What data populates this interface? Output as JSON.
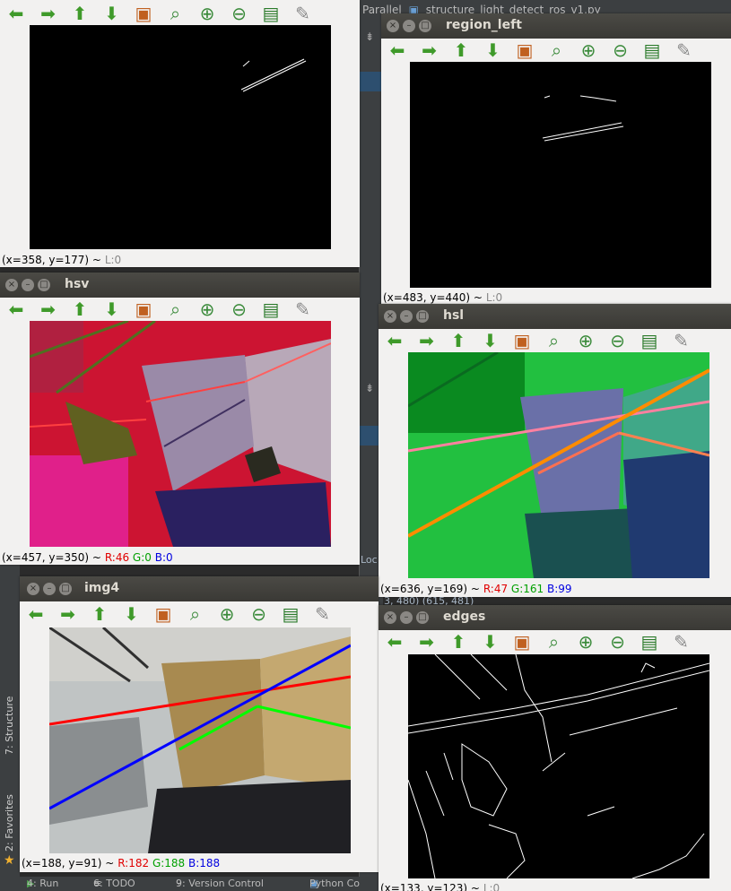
{
  "ide": {
    "tab_label_1": "Parallel",
    "tab_label_2": "structure_light_detect_ros_v1.py",
    "side_tab_structure": "7: Structure",
    "side_tab_favorites": "2: Favorites",
    "bottom_run": "4: Run",
    "bottom_todo": "6: TODO",
    "bottom_vcs": "9: Version Control",
    "bottom_python": "Python Co",
    "misc_loc": "Loc",
    "misc_coords": "3, 480)  (615, 481)"
  },
  "toolbar_icons": [
    "arrow-left-icon",
    "arrow-right-icon",
    "arrow-up-icon",
    "arrow-down-icon",
    "save-image-icon",
    "zoom-area-icon",
    "zoom-in-icon",
    "zoom-out-icon",
    "save-icon",
    "edit-brush-icon"
  ],
  "windows": {
    "mask_top": {
      "status": "(x=358, y=177) ~",
      "channel_label": "L:0"
    },
    "region_left": {
      "title": "region_left",
      "status": "(x=483, y=440) ~",
      "channel_label": "L:0"
    },
    "hsv": {
      "title": "hsv",
      "status": "(x=457, y=350) ~",
      "r": "R:46",
      "g": "G:0",
      "b": "B:0"
    },
    "hsl": {
      "title": "hsl",
      "status": "(x=636, y=169) ~",
      "r": "R:47",
      "g": "G:161",
      "b": "B:99"
    },
    "img4": {
      "title": "img4",
      "status": "(x=188, y=91) ~",
      "r": "R:182",
      "g": "G:188",
      "b": "B:188"
    },
    "edges": {
      "title": "edges",
      "status": "(x=133, y=123) ~",
      "channel_label": "L:0"
    }
  },
  "colors": {
    "title_bar": "#3d3c38",
    "toolbar_green": "#3f9a2a",
    "red_line": "#ff0000",
    "green_line": "#00ff00",
    "blue_line": "#0000ff",
    "orange_line": "#ff8c00",
    "pink_line": "#ff80a0"
  }
}
